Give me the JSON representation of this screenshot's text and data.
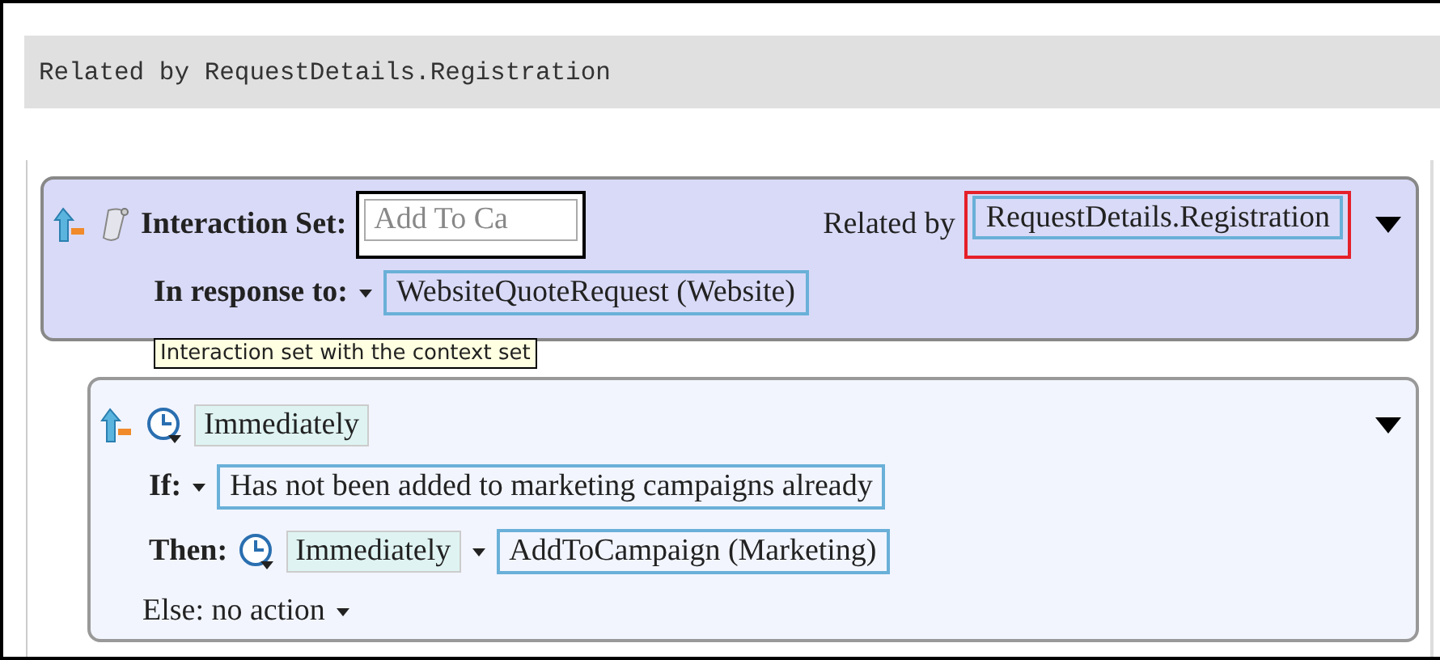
{
  "header": {
    "text": "Related by RequestDetails.Registration"
  },
  "interaction_set": {
    "label": "Interaction Set:",
    "name_value": "Add To Ca",
    "name_focused": true,
    "related_label": "Related by",
    "related_value": "RequestDetails.Registration",
    "related_highlighted": true,
    "response_label": "In response to:",
    "response_value": "WebsiteQuoteRequest (Website)"
  },
  "tooltip": {
    "text": "Interaction set with the context set"
  },
  "interaction": {
    "timing": "Immediately",
    "if_label": "If:",
    "condition": "Has not been added to marketing campaigns already",
    "then_label": "Then:",
    "then_timing": "Immediately",
    "action": "AddToCampaign (Marketing)",
    "else_text": "Else: no action"
  }
}
